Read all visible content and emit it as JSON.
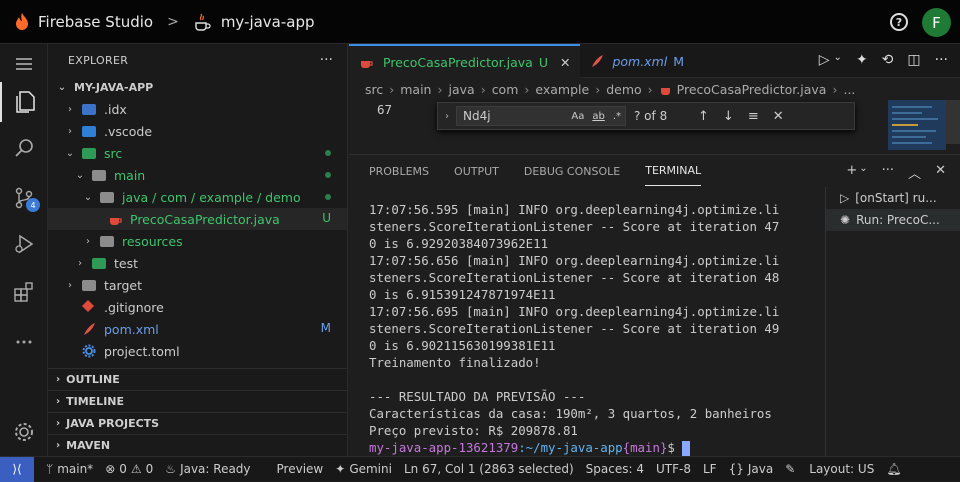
{
  "topbar": {
    "brand": "Firebase Studio",
    "separator": ">",
    "project": "my-java-app",
    "help_glyph": "?",
    "avatar_initial": "F"
  },
  "activity": {
    "scm_badge": "4"
  },
  "explorer": {
    "title": "EXPLORER",
    "more": "···",
    "root": "MY-JAVA-APP",
    "items": [
      {
        "label": ".idx"
      },
      {
        "label": ".vscode"
      },
      {
        "label": "src"
      },
      {
        "label": "main"
      },
      {
        "label": "java / com / example / demo"
      },
      {
        "label": "PrecoCasaPredictor.java",
        "status": "U"
      },
      {
        "label": "resources"
      },
      {
        "label": "test"
      },
      {
        "label": "target"
      },
      {
        "label": ".gitignore"
      },
      {
        "label": "pom.xml",
        "status": "M"
      },
      {
        "label": "project.toml"
      }
    ],
    "sections": [
      "OUTLINE",
      "TIMELINE",
      "JAVA PROJECTS",
      "MAVEN"
    ]
  },
  "editor": {
    "tabs": [
      {
        "label": "PrecoCasaPredictor.java",
        "status": "U"
      },
      {
        "label": "pom.xml",
        "status": "M"
      }
    ],
    "breadcrumb": [
      "src",
      "main",
      "java",
      "com",
      "example",
      "demo",
      "PrecoCasaPredictor.java",
      "..."
    ],
    "line_number": "67",
    "find": {
      "value": "Nd4j",
      "count": "? of 8",
      "opt_case": "Aa",
      "opt_word": "ab",
      "opt_regex": ".*"
    }
  },
  "panel": {
    "tabs": [
      "PROBLEMS",
      "OUTPUT",
      "DEBUG CONSOLE",
      "TERMINAL"
    ],
    "terminal_lines": [
      "17:07:56.595 [main] INFO org.deeplearning4j.optimize.li",
      "steners.ScoreIterationListener -- Score at iteration 47",
      "0 is 6.92920384073962E11",
      "17:07:56.656 [main] INFO org.deeplearning4j.optimize.li",
      "steners.ScoreIterationListener -- Score at iteration 48",
      "0 is 6.915391247871974E11",
      "17:07:56.695 [main] INFO org.deeplearning4j.optimize.li",
      "steners.ScoreIterationListener -- Score at iteration 49",
      "0 is 6.902115630199381E11",
      "Treinamento finalizado!",
      "",
      "--- RESULTADO DA PREVISÃO ---",
      "Características da casa: 190m², 3 quartos, 2 banheiros",
      "Preço previsto: R$ 209878.81"
    ],
    "prompt_user": "my-java-app-13621379",
    "prompt_path": ":~/my-java-app",
    "prompt_branch": "{main}",
    "prompt_sign": "$",
    "terminals": [
      "[onStart] ru...",
      "Run: PrecoC..."
    ]
  },
  "status": {
    "branch": "main*",
    "errors": "0",
    "warnings": "0",
    "java": "Java: Ready",
    "preview": "Preview",
    "gemini": "Gemini",
    "cursor": "Ln 67, Col 1 (2863 selected)",
    "spaces": "Spaces: 4",
    "encoding": "UTF-8",
    "eol": "LF",
    "language": "Java",
    "layout": "Layout: US"
  }
}
